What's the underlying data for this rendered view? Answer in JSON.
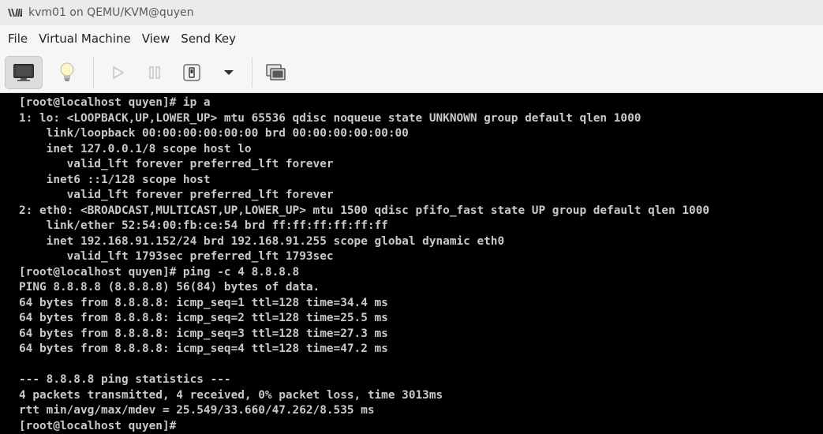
{
  "window": {
    "title": "kvm01 on QEMU/KVM@quyen"
  },
  "menu": {
    "items": [
      "File",
      "Virtual Machine",
      "View",
      "Send Key"
    ]
  },
  "toolbar": {
    "buttons": [
      {
        "name": "console-view",
        "icon": "monitor-icon",
        "active": true
      },
      {
        "name": "details-view",
        "icon": "lightbulb-icon",
        "active": false
      },
      {
        "name": "run",
        "icon": "play-icon",
        "active": false,
        "disabled": true
      },
      {
        "name": "pause",
        "icon": "pause-icon",
        "active": false,
        "disabled": true
      },
      {
        "name": "shutdown",
        "icon": "power-icon",
        "active": false
      },
      {
        "name": "shutdown-menu",
        "icon": "chevron-down-icon",
        "active": false
      },
      {
        "name": "snapshots",
        "icon": "snapshot-icon",
        "active": false
      }
    ]
  },
  "console": {
    "lines": [
      "[root@localhost quyen]# ip a",
      "1: lo: <LOOPBACK,UP,LOWER_UP> mtu 65536 qdisc noqueue state UNKNOWN group default qlen 1000",
      "    link/loopback 00:00:00:00:00:00 brd 00:00:00:00:00:00",
      "    inet 127.0.0.1/8 scope host lo",
      "       valid_lft forever preferred_lft forever",
      "    inet6 ::1/128 scope host",
      "       valid_lft forever preferred_lft forever",
      "2: eth0: <BROADCAST,MULTICAST,UP,LOWER_UP> mtu 1500 qdisc pfifo_fast state UP group default qlen 1000",
      "    link/ether 52:54:00:fb:ce:54 brd ff:ff:ff:ff:ff:ff",
      "    inet 192.168.91.152/24 brd 192.168.91.255 scope global dynamic eth0",
      "       valid_lft 1793sec preferred_lft 1793sec",
      "[root@localhost quyen]# ping -c 4 8.8.8.8",
      "PING 8.8.8.8 (8.8.8.8) 56(84) bytes of data.",
      "64 bytes from 8.8.8.8: icmp_seq=1 ttl=128 time=34.4 ms",
      "64 bytes from 8.8.8.8: icmp_seq=2 ttl=128 time=25.5 ms",
      "64 bytes from 8.8.8.8: icmp_seq=3 ttl=128 time=27.3 ms",
      "64 bytes from 8.8.8.8: icmp_seq=4 ttl=128 time=47.2 ms",
      "",
      "--- 8.8.8.8 ping statistics ---",
      "4 packets transmitted, 4 received, 0% packet loss, time 3013ms",
      "rtt min/avg/max/mdev = 25.549/33.660/47.262/8.535 ms",
      "[root@localhost quyen]#"
    ]
  },
  "colors": {
    "console_bg": "#000000",
    "console_fg": "#c9c9c9",
    "toolbar_bg": "#f6f6f6"
  }
}
